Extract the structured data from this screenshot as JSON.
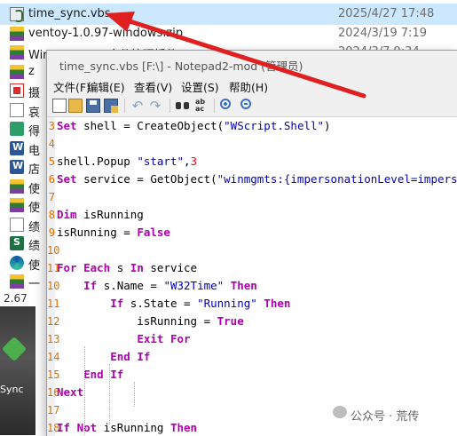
{
  "explorer": {
    "files": [
      {
        "name": "time_sync.vbs",
        "date": "2025/4/27 17:48",
        "icon": "vbs-script-icon",
        "selected": true
      },
      {
        "name": "ventoy-1.0.97-windows.zip",
        "date": "2024/3/19 7:19",
        "icon": "zip-archive-icon"
      },
      {
        "name": "Windows-VMP文件管理插件.zip",
        "date": "2024/3/7 9:34",
        "icon": "zip-archive-icon"
      },
      {
        "name": "z",
        "date": "",
        "icon": "zip-archive-icon"
      },
      {
        "name": "摄",
        "date": "",
        "icon": "pdf-icon"
      },
      {
        "name": "哀",
        "date": "",
        "icon": "image-icon"
      },
      {
        "name": "得",
        "date": "",
        "icon": "green-app-icon"
      },
      {
        "name": "电",
        "date": "",
        "icon": "word-doc-icon"
      },
      {
        "name": "店",
        "date": "",
        "icon": "word-doc-icon"
      },
      {
        "name": "使",
        "date": "",
        "icon": "zip-archive-icon"
      },
      {
        "name": "使",
        "date": "",
        "icon": "zip-archive-icon"
      },
      {
        "name": "绩",
        "date": "",
        "icon": "text-file-icon"
      },
      {
        "name": "绩",
        "date": "",
        "icon": "excel-sheet-icon"
      },
      {
        "name": "使",
        "date": "",
        "icon": "edge-browser-icon"
      },
      {
        "name": "一",
        "date": "",
        "icon": "zip-archive-icon"
      }
    ],
    "status_size": "2.67",
    "desktop_label": "Sync"
  },
  "notepad": {
    "title": "time_sync.vbs [F:\\] - Notepad2-mod (管理员)",
    "menu": [
      "文件(F)",
      "编辑(E)",
      "查看(V)",
      "设置(S)",
      "帮助(H)"
    ],
    "toolbar": [
      "new-file-icon",
      "open-folder-icon",
      "save-icon",
      "save-as-icon",
      "undo-icon",
      "redo-icon",
      "find-icon",
      "replace-icon",
      "zoom-in-icon",
      "zoom-out-icon"
    ],
    "lines": [
      {
        "n": "3",
        "tokens": [
          {
            "t": "kw",
            "v": "Set"
          },
          {
            "t": "",
            "v": " shell = CreateObject("
          },
          {
            "t": "str",
            "v": "\"WScript.Shell\""
          },
          {
            "t": "",
            "v": ")"
          }
        ]
      },
      {
        "n": "4",
        "tokens": []
      },
      {
        "n": "5",
        "tokens": [
          {
            "t": "",
            "v": "shell.Popup "
          },
          {
            "t": "str",
            "v": "\"start\""
          },
          {
            "t": "",
            "v": ","
          },
          {
            "t": "num",
            "v": "3"
          }
        ]
      },
      {
        "n": "6",
        "tokens": [
          {
            "t": "kw",
            "v": "Set"
          },
          {
            "t": "",
            "v": " service = GetObject("
          },
          {
            "t": "str",
            "v": "\"winmgmts:{impersonationLevel=impersonate"
          }
        ]
      },
      {
        "n": "7",
        "tokens": []
      },
      {
        "n": "8",
        "tokens": [
          {
            "t": "kw",
            "v": "Dim"
          },
          {
            "t": "",
            "v": " isRunning"
          }
        ]
      },
      {
        "n": "9",
        "tokens": [
          {
            "t": "",
            "v": "isRunning = "
          },
          {
            "t": "kw",
            "v": "False"
          }
        ]
      },
      {
        "n": "10",
        "tokens": []
      },
      {
        "n": "11",
        "tokens": [
          {
            "t": "kw",
            "v": "For Each"
          },
          {
            "t": "",
            "v": " s "
          },
          {
            "t": "kw",
            "v": "In"
          },
          {
            "t": "",
            "v": " service"
          }
        ]
      },
      {
        "n": "10",
        "tokens": [
          {
            "t": "",
            "v": "    "
          },
          {
            "t": "kw",
            "v": "If"
          },
          {
            "t": "",
            "v": " s.Name = "
          },
          {
            "t": "str",
            "v": "\"W32Time\""
          },
          {
            "t": "",
            "v": " "
          },
          {
            "t": "kw",
            "v": "Then"
          }
        ]
      },
      {
        "n": "11",
        "tokens": [
          {
            "t": "",
            "v": "        "
          },
          {
            "t": "kw",
            "v": "If"
          },
          {
            "t": "",
            "v": " s.State = "
          },
          {
            "t": "str",
            "v": "\"Running\""
          },
          {
            "t": "",
            "v": " "
          },
          {
            "t": "kw",
            "v": "Then"
          }
        ]
      },
      {
        "n": "12",
        "tokens": [
          {
            "t": "",
            "v": "            isRunning = "
          },
          {
            "t": "kw",
            "v": "True"
          }
        ]
      },
      {
        "n": "13",
        "tokens": [
          {
            "t": "",
            "v": "            "
          },
          {
            "t": "kw",
            "v": "Exit For"
          }
        ]
      },
      {
        "n": "14",
        "tokens": [
          {
            "t": "",
            "v": "        "
          },
          {
            "t": "kw",
            "v": "End If"
          }
        ]
      },
      {
        "n": "15",
        "tokens": [
          {
            "t": "",
            "v": "    "
          },
          {
            "t": "kw",
            "v": "End If"
          }
        ]
      },
      {
        "n": "16",
        "tokens": [
          {
            "t": "kw",
            "v": "Next"
          }
        ]
      },
      {
        "n": "17",
        "tokens": []
      },
      {
        "n": "18",
        "tokens": [
          {
            "t": "kw",
            "v": "If Not"
          },
          {
            "t": "",
            "v": " isRunning "
          },
          {
            "t": "kw",
            "v": "Then"
          }
        ]
      }
    ]
  },
  "watermark": "公众号 · 荒传",
  "colors": {
    "arrow": "#e02020",
    "selection": "#cce8ff",
    "keyword": "#b000b0",
    "string": "#0000c0",
    "number": "#ff0000",
    "line_number": "#e06e00"
  }
}
